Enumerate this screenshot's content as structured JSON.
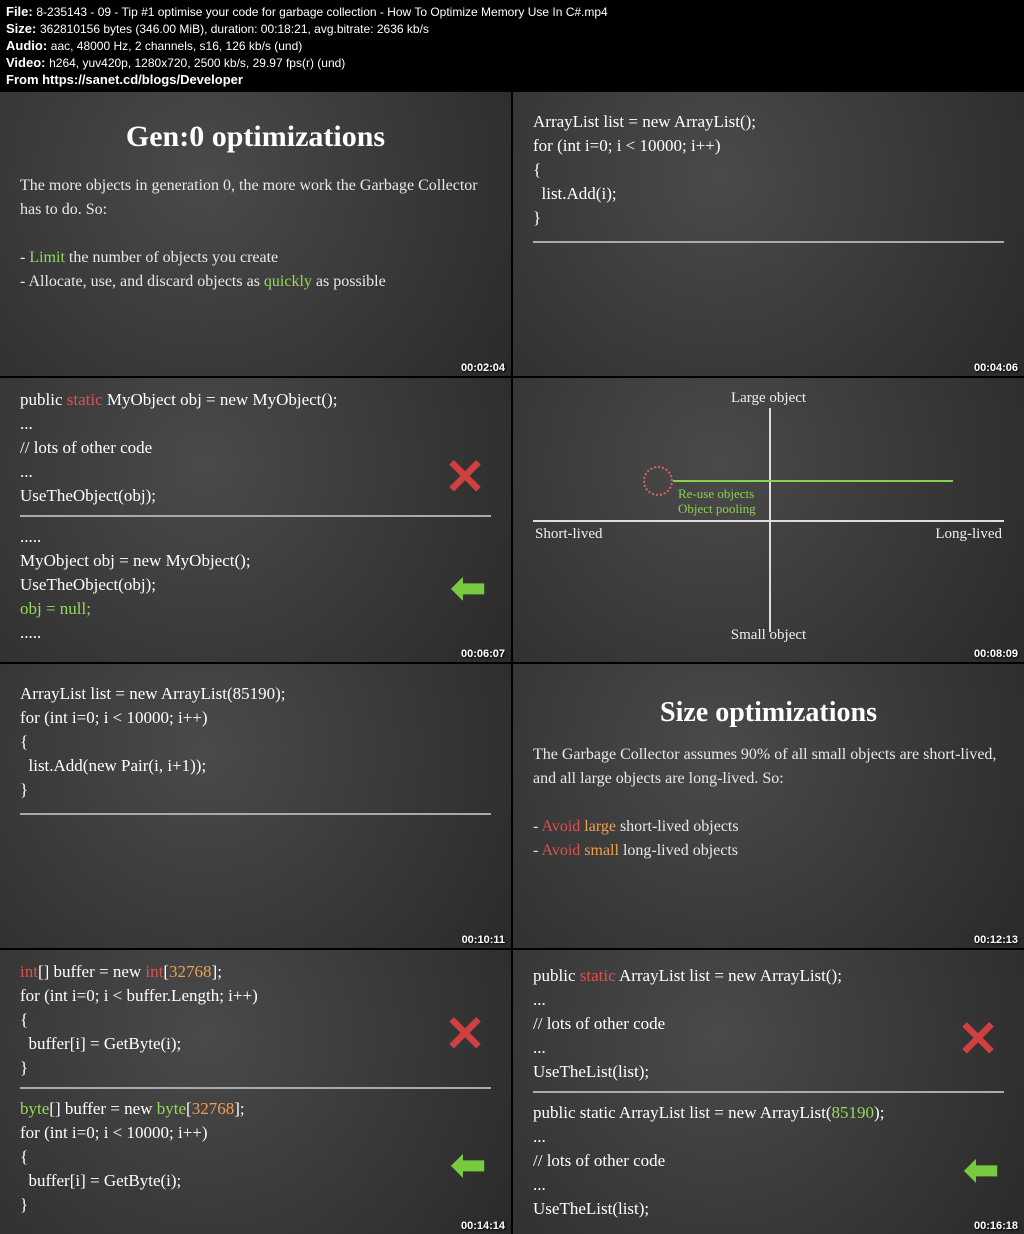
{
  "header": {
    "file_label": "File: ",
    "file_value": "8-235143 - 09 - Tip #1 optimise your code for garbage collection - How To Optimize Memory Use In C#.mp4",
    "size_label": "Size: ",
    "size_value": "362810156 bytes (346.00 MiB), duration: 00:18:21, avg.bitrate: 2636 kb/s",
    "audio_label": "Audio: ",
    "audio_value": "aac, 48000 Hz, 2 channels, s16, 126 kb/s (und)",
    "video_label": "Video: ",
    "video_value": "h264, yuv420p, 1280x720, 2500 kb/s, 29.97 fps(r) (und)",
    "from": "From https://sanet.cd/blogs/Developer"
  },
  "cells": [
    {
      "ts": "00:02:04",
      "title": "Gen:0 optimizations",
      "body_intro": "The more objects in generation 0, the more work the Garbage Collector has to do. So:",
      "bullet1a": "- ",
      "bullet1b": "Limit",
      "bullet1c": " the number of objects you create",
      "bullet2a": "- Allocate, use, and discard objects as ",
      "bullet2b": "quickly",
      "bullet2c": " as possible"
    },
    {
      "ts": "00:04:06",
      "code1": "ArrayList list = new ArrayList();\nfor (int i=0; i < 10000; i++)\n{\n  list.Add(i);\n}"
    },
    {
      "ts": "00:06:07",
      "code_top1": "public ",
      "code_top2": "static",
      "code_top3": " MyObject obj = new MyObject();\n...\n// lots of other code\n...\nUseTheObject(obj);",
      "code_bot1": ".....\nMyObject obj = new MyObject();\nUseTheObject(obj);\n",
      "code_bot2": "obj = null;",
      "code_bot3": "\n....."
    },
    {
      "ts": "00:08:09",
      "top": "Large object",
      "bottom": "Small object",
      "left": "Short-lived",
      "right": "Long-lived",
      "ann1": "Re-use objects",
      "ann2": "Object pooling"
    },
    {
      "ts": "00:10:11",
      "code1": "ArrayList list = new ArrayList(85190);\nfor (int i=0; i < 10000; i++)\n{\n  list.Add(new Pair(i, i+1));\n}"
    },
    {
      "ts": "00:12:13",
      "title": "Size optimizations",
      "body_intro": "The Garbage Collector assumes 90% of all small objects are short-lived, and all large objects are long-lived. So:",
      "b1a": "- ",
      "b1b": "Avoid",
      "b1c": " large",
      "b1d": " short-lived objects",
      "b2a": "- ",
      "b2b": "Avoid",
      "b2c": " small",
      "b2d": " long-lived objects"
    },
    {
      "ts": "00:14:14",
      "c1a": "int",
      "c1b": "[] buffer = new ",
      "c1c": "int",
      "c1d": "[",
      "c1e": "32768",
      "c1f": "];\nfor (int i=0; i < buffer.Length; i++)\n{\n  buffer[i] = GetByte(i);\n}",
      "c2a": "byte",
      "c2b": "[] buffer = new ",
      "c2c": "byte",
      "c2d": "[",
      "c2e": "32768",
      "c2f": "];\nfor (int i=0; i < 10000; i++)\n{\n  buffer[i] = GetByte(i);\n}"
    },
    {
      "ts": "00:16:18",
      "c1a": "public ",
      "c1b": "static",
      "c1c": " ArrayList list = new ArrayList();\n...\n// lots of other code\n...\nUseTheList(list);",
      "c2a": "public static ArrayList list = new ArrayList(",
      "c2b": "85190",
      "c2c": ");\n...\n// lots of other code\n...\nUseTheList(list);"
    }
  ],
  "icons": {
    "wrong": "✕",
    "right": "⬅"
  }
}
